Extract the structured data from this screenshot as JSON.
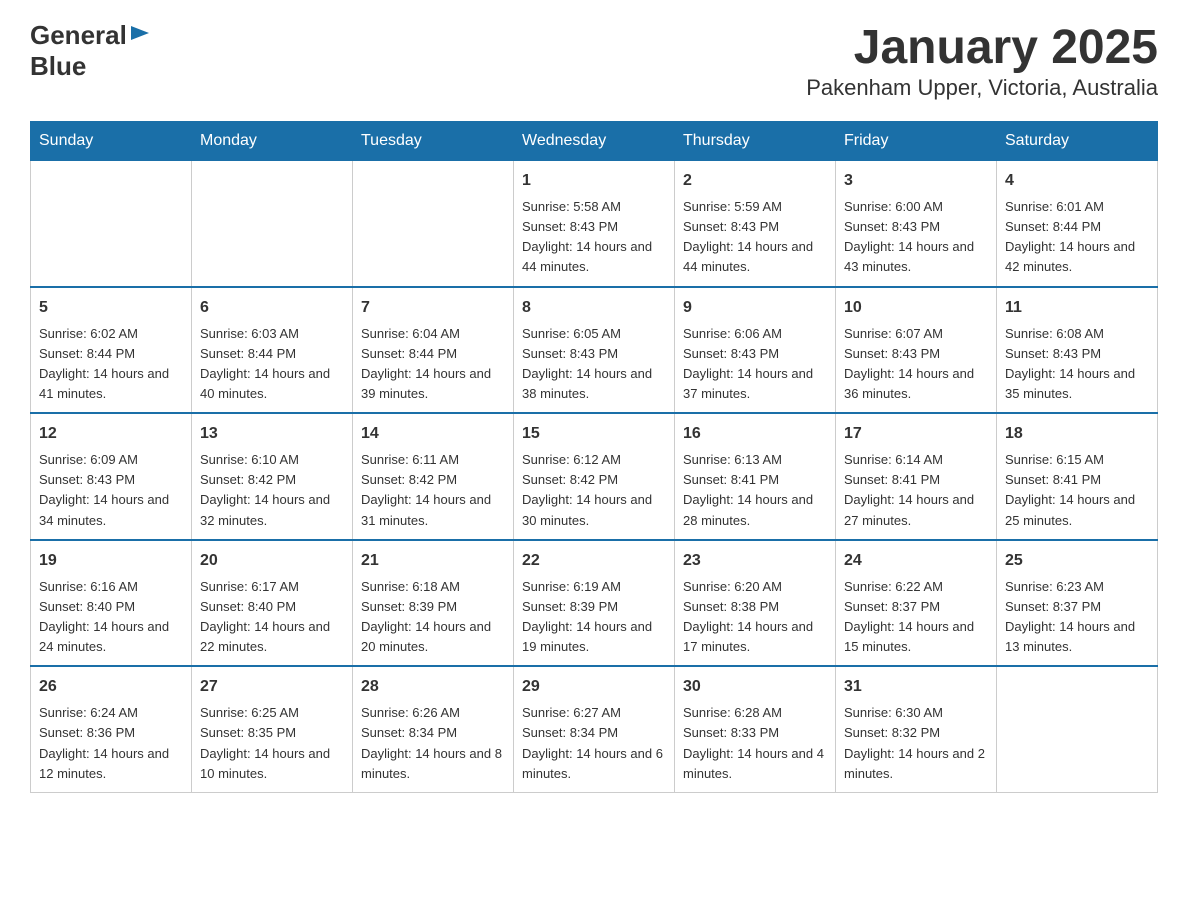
{
  "header": {
    "logo_general": "General",
    "logo_blue": "Blue",
    "title": "January 2025",
    "subtitle": "Pakenham Upper, Victoria, Australia"
  },
  "days_of_week": [
    "Sunday",
    "Monday",
    "Tuesday",
    "Wednesday",
    "Thursday",
    "Friday",
    "Saturday"
  ],
  "weeks": [
    [
      {
        "day": "",
        "info": ""
      },
      {
        "day": "",
        "info": ""
      },
      {
        "day": "",
        "info": ""
      },
      {
        "day": "1",
        "info": "Sunrise: 5:58 AM\nSunset: 8:43 PM\nDaylight: 14 hours and 44 minutes."
      },
      {
        "day": "2",
        "info": "Sunrise: 5:59 AM\nSunset: 8:43 PM\nDaylight: 14 hours and 44 minutes."
      },
      {
        "day": "3",
        "info": "Sunrise: 6:00 AM\nSunset: 8:43 PM\nDaylight: 14 hours and 43 minutes."
      },
      {
        "day": "4",
        "info": "Sunrise: 6:01 AM\nSunset: 8:44 PM\nDaylight: 14 hours and 42 minutes."
      }
    ],
    [
      {
        "day": "5",
        "info": "Sunrise: 6:02 AM\nSunset: 8:44 PM\nDaylight: 14 hours and 41 minutes."
      },
      {
        "day": "6",
        "info": "Sunrise: 6:03 AM\nSunset: 8:44 PM\nDaylight: 14 hours and 40 minutes."
      },
      {
        "day": "7",
        "info": "Sunrise: 6:04 AM\nSunset: 8:44 PM\nDaylight: 14 hours and 39 minutes."
      },
      {
        "day": "8",
        "info": "Sunrise: 6:05 AM\nSunset: 8:43 PM\nDaylight: 14 hours and 38 minutes."
      },
      {
        "day": "9",
        "info": "Sunrise: 6:06 AM\nSunset: 8:43 PM\nDaylight: 14 hours and 37 minutes."
      },
      {
        "day": "10",
        "info": "Sunrise: 6:07 AM\nSunset: 8:43 PM\nDaylight: 14 hours and 36 minutes."
      },
      {
        "day": "11",
        "info": "Sunrise: 6:08 AM\nSunset: 8:43 PM\nDaylight: 14 hours and 35 minutes."
      }
    ],
    [
      {
        "day": "12",
        "info": "Sunrise: 6:09 AM\nSunset: 8:43 PM\nDaylight: 14 hours and 34 minutes."
      },
      {
        "day": "13",
        "info": "Sunrise: 6:10 AM\nSunset: 8:42 PM\nDaylight: 14 hours and 32 minutes."
      },
      {
        "day": "14",
        "info": "Sunrise: 6:11 AM\nSunset: 8:42 PM\nDaylight: 14 hours and 31 minutes."
      },
      {
        "day": "15",
        "info": "Sunrise: 6:12 AM\nSunset: 8:42 PM\nDaylight: 14 hours and 30 minutes."
      },
      {
        "day": "16",
        "info": "Sunrise: 6:13 AM\nSunset: 8:41 PM\nDaylight: 14 hours and 28 minutes."
      },
      {
        "day": "17",
        "info": "Sunrise: 6:14 AM\nSunset: 8:41 PM\nDaylight: 14 hours and 27 minutes."
      },
      {
        "day": "18",
        "info": "Sunrise: 6:15 AM\nSunset: 8:41 PM\nDaylight: 14 hours and 25 minutes."
      }
    ],
    [
      {
        "day": "19",
        "info": "Sunrise: 6:16 AM\nSunset: 8:40 PM\nDaylight: 14 hours and 24 minutes."
      },
      {
        "day": "20",
        "info": "Sunrise: 6:17 AM\nSunset: 8:40 PM\nDaylight: 14 hours and 22 minutes."
      },
      {
        "day": "21",
        "info": "Sunrise: 6:18 AM\nSunset: 8:39 PM\nDaylight: 14 hours and 20 minutes."
      },
      {
        "day": "22",
        "info": "Sunrise: 6:19 AM\nSunset: 8:39 PM\nDaylight: 14 hours and 19 minutes."
      },
      {
        "day": "23",
        "info": "Sunrise: 6:20 AM\nSunset: 8:38 PM\nDaylight: 14 hours and 17 minutes."
      },
      {
        "day": "24",
        "info": "Sunrise: 6:22 AM\nSunset: 8:37 PM\nDaylight: 14 hours and 15 minutes."
      },
      {
        "day": "25",
        "info": "Sunrise: 6:23 AM\nSunset: 8:37 PM\nDaylight: 14 hours and 13 minutes."
      }
    ],
    [
      {
        "day": "26",
        "info": "Sunrise: 6:24 AM\nSunset: 8:36 PM\nDaylight: 14 hours and 12 minutes."
      },
      {
        "day": "27",
        "info": "Sunrise: 6:25 AM\nSunset: 8:35 PM\nDaylight: 14 hours and 10 minutes."
      },
      {
        "day": "28",
        "info": "Sunrise: 6:26 AM\nSunset: 8:34 PM\nDaylight: 14 hours and 8 minutes."
      },
      {
        "day": "29",
        "info": "Sunrise: 6:27 AM\nSunset: 8:34 PM\nDaylight: 14 hours and 6 minutes."
      },
      {
        "day": "30",
        "info": "Sunrise: 6:28 AM\nSunset: 8:33 PM\nDaylight: 14 hours and 4 minutes."
      },
      {
        "day": "31",
        "info": "Sunrise: 6:30 AM\nSunset: 8:32 PM\nDaylight: 14 hours and 2 minutes."
      },
      {
        "day": "",
        "info": ""
      }
    ]
  ]
}
